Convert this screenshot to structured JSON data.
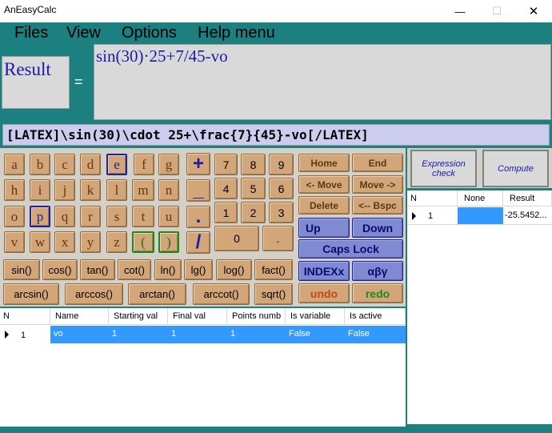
{
  "window": {
    "title": "AnEasyCalc",
    "minimize": "—",
    "maximize": "☐",
    "close": "✕"
  },
  "menu": [
    "Files",
    "View",
    "Options",
    "Help menu"
  ],
  "result_label": "Result",
  "equals": "=",
  "expression": "sin(30)·25+7/45-vo",
  "latex": "[LATEX]\\sin(30)\\cdot 25+\\frac{7}{45}-vo[/LATEX]",
  "letters": [
    "a",
    "b",
    "c",
    "d",
    "e",
    "f",
    "g",
    "h",
    "i",
    "j",
    "k",
    "l",
    "m",
    "n",
    "o",
    "p",
    "q",
    "r",
    "s",
    "t",
    "u",
    "v",
    "w",
    "x",
    "y",
    "z",
    "(",
    ")"
  ],
  "ops": {
    "plus": "+",
    "minus": "_",
    "dot": ".",
    "div": "/"
  },
  "digits": [
    "7",
    "8",
    "9",
    "4",
    "5",
    "6",
    "1",
    "2",
    "3",
    "0",
    "."
  ],
  "funcs1": [
    "sin()",
    "cos()",
    "tan()",
    "cot()",
    "ln()",
    "lg()",
    "log()",
    "fact()"
  ],
  "funcs2": [
    "arcsin()",
    "arccos()",
    "arctan()",
    "arccot()",
    "sqrt()"
  ],
  "nav": {
    "home": "Home",
    "end": "End",
    "move_left": "<- Move",
    "move_right": "Move ->",
    "delete": "Delete",
    "bspc": "<-- Bspc",
    "up": "Up",
    "down": "Down",
    "caps": "Caps Lock",
    "index": "INDEXx",
    "greek": "αβγ",
    "undo": "undo",
    "redo": "redo"
  },
  "right_buttons": {
    "expr_check": "Expression check",
    "compute": "Compute"
  },
  "results_grid": {
    "headers": [
      "N",
      "None",
      "Result"
    ],
    "rows": [
      {
        "n": "1",
        "none": "",
        "result": "-25.5452..."
      }
    ]
  },
  "vars_grid": {
    "headers": [
      "N",
      "Name",
      "Starting val",
      "Final val",
      "Points numb",
      "Is variable",
      "Is active"
    ],
    "rows": [
      {
        "n": "1",
        "name": "vo",
        "start": "1",
        "final": "1",
        "points": "1",
        "is_var": "False",
        "is_active": "False"
      }
    ]
  },
  "colors": {
    "frame": "#1c7f80",
    "key": "#d2a679",
    "blue_key": "#7f8ad2",
    "selection": "#3399ff"
  }
}
